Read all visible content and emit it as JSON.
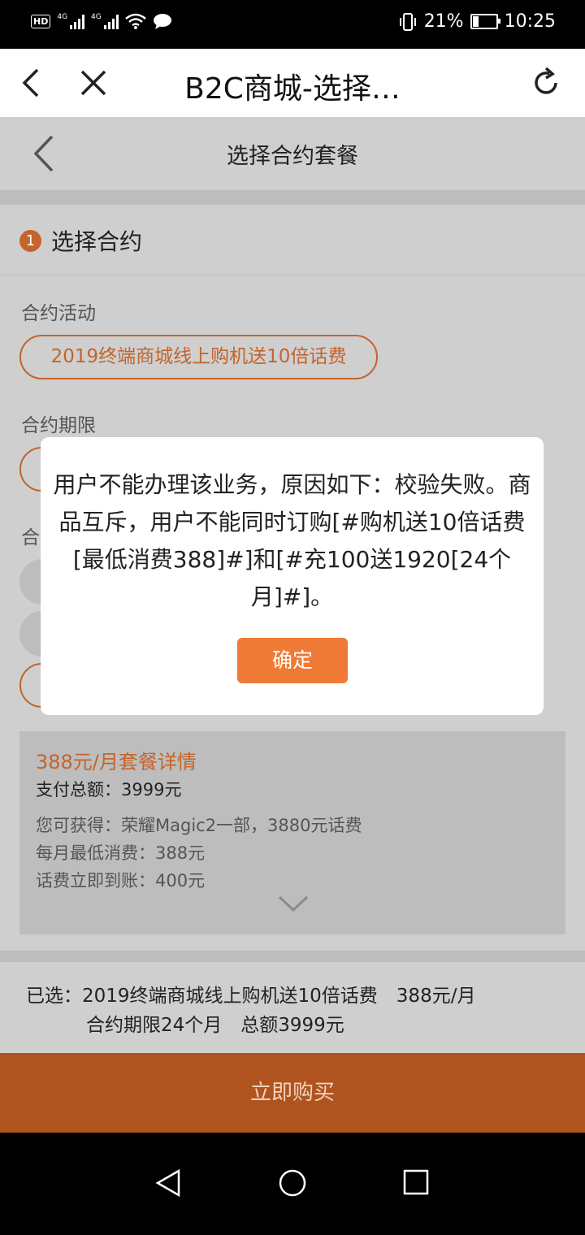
{
  "status_bar": {
    "badge": "HD",
    "net1": "4G",
    "net2": "4G",
    "battery_percent": "21%",
    "time": "10:25"
  },
  "browser": {
    "title": "B2C商城-选择…"
  },
  "page": {
    "title": "选择合约套餐",
    "step_number": "1",
    "step_label": "选择合约",
    "contract_activity_label": "合约活动",
    "contract_activity_option": "2019终端商城线上购机送10倍话费",
    "contract_period_label": "合约期限",
    "partial_label": "合"
  },
  "detail": {
    "title": "388元/月套餐详情",
    "total": "支付总额：3999元",
    "line1": "您可获得：荣耀Magic2一部，3880元话费",
    "line2": "每月最低消费：388元",
    "line3": "话费立即到账：400元"
  },
  "summary": {
    "line1": "已选：2019终端商城线上购机送10倍话费　388元/月",
    "line2": "合约期限24个月　总额3999元"
  },
  "buy_button": "立即购买",
  "dialog": {
    "message": "用户不能办理该业务，原因如下：校验失败。商品互斥，用户不能同时订购[#购机送10倍话费[最低消费388]#]和[#充100送1920[24个月]#]。",
    "confirm": "确定"
  },
  "colors": {
    "accent": "#ef7a35",
    "accent_dim": "#c4642a",
    "buy_bg": "#b0541f"
  }
}
